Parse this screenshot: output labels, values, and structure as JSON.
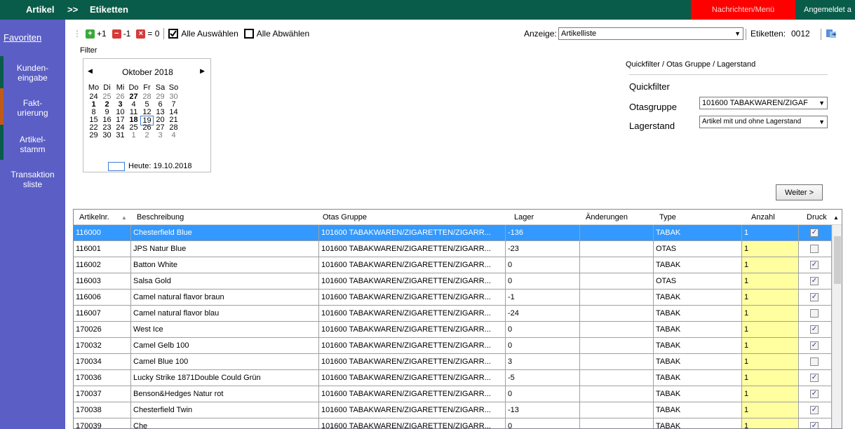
{
  "topbar": {
    "artikel": "Artikel",
    "sep": ">>",
    "etiketten": "Etiketten",
    "nachrichten": "Nachrichten/Menü",
    "user": "Angemeldet a",
    "colors": {
      "bar": "#0a5c4a",
      "alert": "#ff0000"
    }
  },
  "sidebar": {
    "favoriten": "Favoriten",
    "items": [
      "Kunden-\neingabe",
      "Fakt-\nurierung",
      "Artikel-\nstamm",
      "Transaktion\nsliste"
    ]
  },
  "toolbar": {
    "plus": "+1",
    "minus": "-1",
    "zero": "= 0",
    "alle_auswaehlen": "Alle Auswählen",
    "alle_abwaehlen": "Alle Abwählen",
    "anzeige_label": "Anzeige:",
    "anzeige_value": "Artikelliste",
    "etiketten_label": "Etiketten:",
    "etiketten_count": "0012"
  },
  "filter": {
    "label": "Filter"
  },
  "calendar": {
    "month": "Oktober 2018",
    "weekdays": [
      "Mo",
      "Di",
      "Mi",
      "Do",
      "Fr",
      "Sa",
      "So"
    ],
    "weeks": [
      [
        "24",
        "25",
        "26",
        "27",
        "28",
        "29",
        "30"
      ],
      [
        "1",
        "2",
        "3",
        "4",
        "5",
        "6",
        "7"
      ],
      [
        "8",
        "9",
        "10",
        "11",
        "12",
        "13",
        "14"
      ],
      [
        "15",
        "16",
        "17",
        "18",
        "19",
        "20",
        "21"
      ],
      [
        "22",
        "23",
        "24",
        "25",
        "26",
        "27",
        "28"
      ],
      [
        "29",
        "30",
        "31",
        "1",
        "2",
        "3",
        "4"
      ]
    ],
    "today_label": "Heute: 19.10.2018"
  },
  "quickfilter": {
    "title": "Quickfilter / Otas Gruppe / Lagerstand",
    "quickfilter_label": "Quickfilter",
    "otasgruppe_label": "Otasgruppe",
    "otasgruppe_value": "101600 TABAKWAREN/ZIGAF",
    "lagerstand_label": "Lagerstand",
    "lagerstand_value": "Artikel mit und ohne Lagerstand"
  },
  "weiter_button": "Weiter >",
  "grid": {
    "columns": [
      "Artikelnr.",
      "Beschreibung",
      "Otas Gruppe",
      "Lager",
      "Änderungen",
      "Type",
      "Anzahl",
      "Druck"
    ],
    "rows": [
      {
        "nr": "116000",
        "desc": "Chesterfield Blue",
        "gruppe": "101600 TABAKWAREN/ZIGARETTEN/ZIGARR...",
        "lager": "-136",
        "aend": "",
        "type": "TABAK",
        "anzahl": "1",
        "druck": true
      },
      {
        "nr": "116001",
        "desc": "JPS Natur Blue",
        "gruppe": "101600 TABAKWAREN/ZIGARETTEN/ZIGARR...",
        "lager": "-23",
        "aend": "",
        "type": "OTAS",
        "anzahl": "1",
        "druck": false
      },
      {
        "nr": "116002",
        "desc": "Batton White",
        "gruppe": "101600 TABAKWAREN/ZIGARETTEN/ZIGARR...",
        "lager": "0",
        "aend": "",
        "type": "TABAK",
        "anzahl": "1",
        "druck": true
      },
      {
        "nr": "116003",
        "desc": "Salsa Gold",
        "gruppe": "101600 TABAKWAREN/ZIGARETTEN/ZIGARR...",
        "lager": "0",
        "aend": "",
        "type": "OTAS",
        "anzahl": "1",
        "druck": true
      },
      {
        "nr": "116006",
        "desc": "Camel natural flavor braun",
        "gruppe": "101600 TABAKWAREN/ZIGARETTEN/ZIGARR...",
        "lager": "-1",
        "aend": "",
        "type": "TABAK",
        "anzahl": "1",
        "druck": true
      },
      {
        "nr": "116007",
        "desc": "Camel natural flavor blau",
        "gruppe": "101600 TABAKWAREN/ZIGARETTEN/ZIGARR...",
        "lager": "-24",
        "aend": "",
        "type": "TABAK",
        "anzahl": "1",
        "druck": false
      },
      {
        "nr": "170026",
        "desc": "West Ice",
        "gruppe": "101600 TABAKWAREN/ZIGARETTEN/ZIGARR...",
        "lager": "0",
        "aend": "",
        "type": "TABAK",
        "anzahl": "1",
        "druck": true
      },
      {
        "nr": "170032",
        "desc": "Camel Gelb 100",
        "gruppe": "101600 TABAKWAREN/ZIGARETTEN/ZIGARR...",
        "lager": "0",
        "aend": "",
        "type": "TABAK",
        "anzahl": "1",
        "druck": true
      },
      {
        "nr": "170034",
        "desc": "Camel Blue 100",
        "gruppe": "101600 TABAKWAREN/ZIGARETTEN/ZIGARR...",
        "lager": "3",
        "aend": "",
        "type": "TABAK",
        "anzahl": "1",
        "druck": false
      },
      {
        "nr": "170036",
        "desc": "Lucky Strike 1871Double Could Grün",
        "gruppe": "101600 TABAKWAREN/ZIGARETTEN/ZIGARR...",
        "lager": "-5",
        "aend": "",
        "type": "TABAK",
        "anzahl": "1",
        "druck": true
      },
      {
        "nr": "170037",
        "desc": "Benson&Hedges Natur rot",
        "gruppe": "101600 TABAKWAREN/ZIGARETTEN/ZIGARR...",
        "lager": "0",
        "aend": "",
        "type": "TABAK",
        "anzahl": "1",
        "druck": true
      },
      {
        "nr": "170038",
        "desc": "Chesterfield Twin",
        "gruppe": "101600 TABAKWAREN/ZIGARETTEN/ZIGARR...",
        "lager": "-13",
        "aend": "",
        "type": "TABAK",
        "anzahl": "1",
        "druck": true
      },
      {
        "nr": "170039",
        "desc": "Che",
        "gruppe": "101600 TABAKWAREN/ZIGARETTEN/ZIGARR...",
        "lager": "0",
        "aend": "",
        "type": "TABAK",
        "anzahl": "1",
        "druck": true
      }
    ],
    "colors": {
      "selected": "#3399ff",
      "anzahl_bg": "#ffffa0"
    }
  }
}
